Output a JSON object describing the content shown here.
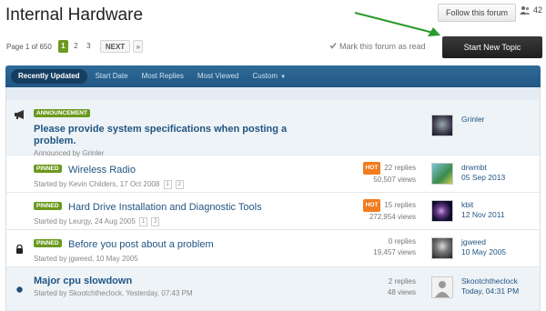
{
  "header": {
    "title": "Internal Hardware",
    "follow_label": "Follow this forum",
    "follower_count": "42"
  },
  "pagination": {
    "label": "Page 1 of 650",
    "pages": [
      "1",
      "2",
      "3"
    ],
    "next_label": "NEXT",
    "last_label": "»"
  },
  "actions": {
    "mark_read_label": "Mark this forum as read",
    "start_topic_label": "Start New Topic"
  },
  "tabs": [
    {
      "label": "Recently Updated",
      "active": true
    },
    {
      "label": "Start Date",
      "active": false
    },
    {
      "label": "Most Replies",
      "active": false
    },
    {
      "label": "Most Viewed",
      "active": false
    },
    {
      "label": "Custom",
      "active": false
    }
  ],
  "announcement": {
    "badge": "ANNOUNCEMENT",
    "title": "Please provide system specifications when posting a problem.",
    "meta": "Announced by Grinler",
    "poster": "Grinler"
  },
  "topics": [
    {
      "badge": "PINNED",
      "title": "Wireless Radio",
      "meta": "Started by Kevin Childers, 17 Oct 2008",
      "pages": [
        "1",
        "2"
      ],
      "hot": "HOT",
      "replies": "22 replies",
      "views": "50,507 views",
      "last_poster": "drwmbt",
      "last_date": "05 Sep 2013"
    },
    {
      "badge": "PINNED",
      "title": "Hard Drive Installation and Diagnostic Tools",
      "meta": "Started by Leurgy, 24 Aug 2005",
      "pages": [
        "1",
        "2"
      ],
      "hot": "HOT",
      "replies": "15 replies",
      "views": "272,954 views",
      "last_poster": "kbit",
      "last_date": "12 Nov 2011"
    },
    {
      "badge": "PINNED",
      "title": "Before you post about a problem",
      "meta": "Started by jgweed, 10 May 2005",
      "replies": "0 replies",
      "views": "19,457 views",
      "last_poster": "jgweed",
      "last_date": "10 May 2005"
    },
    {
      "title": "Major cpu slowdown",
      "meta": "Started by Skootchtheclock, Yesterday, 07:43 PM",
      "replies": "2 replies",
      "views": "48 views",
      "last_poster": "Skootchtheclock",
      "last_date": "Today, 04:31 PM"
    }
  ],
  "colors": {
    "accent_green": "#6b9a1f",
    "hot_orange": "#f27c1e",
    "link_blue": "#215684",
    "arrow_green": "#2a9a2a"
  }
}
